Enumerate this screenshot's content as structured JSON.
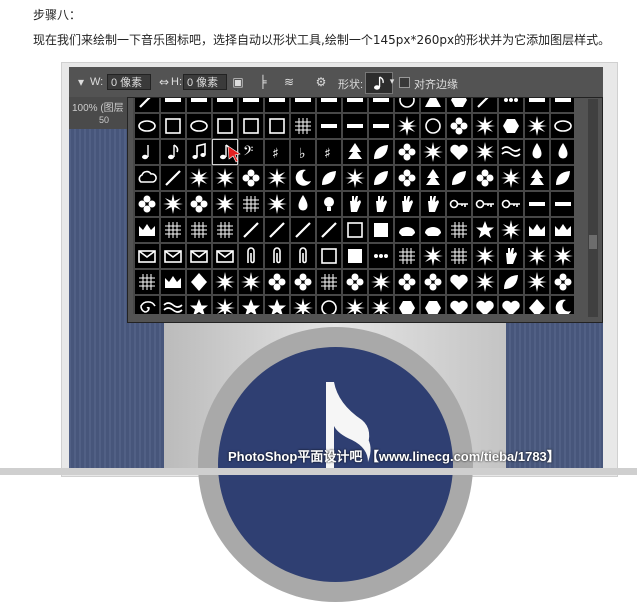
{
  "article": {
    "step_title": "步骤八：",
    "step_text": "现在我们来绘制一下音乐图标吧，选择自动以形状工具,绘制一个145px*260px的形状并为它添加图层样式。"
  },
  "options_bar": {
    "w_label": "W:",
    "w_value": "0 像素",
    "h_label": "H:",
    "h_value": "0 像素",
    "shape_label": "形状:",
    "align_edges_label": "对齐边缘"
  },
  "document": {
    "tab_zoom": "100% (图层",
    "ruler_label": "50"
  },
  "watermark": "PhotoShop平面设计吧 【www.linecg.com/tieba/1783】",
  "colors": {
    "ps_panel": "#535353",
    "canvas_blue": "#4a5a80",
    "disc_blue": "#2f3f72"
  },
  "shape_picker": {
    "selected_shape": "eighth-note-icon"
  }
}
